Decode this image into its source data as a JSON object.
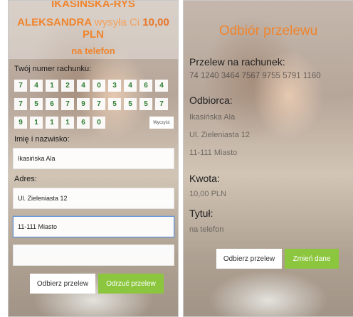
{
  "left": {
    "sender": {
      "name_top": "IKASIŃSKA-RYŚ",
      "name_bottom": "ALEKSANDRA",
      "sends": "wysyła Ci",
      "amount": "10,00",
      "currency": "PLN",
      "title": "na telefon"
    },
    "account_label": "Twój numer rachunku:",
    "digits": [
      [
        "7",
        "4",
        "1",
        "2",
        "4",
        "0",
        "3",
        "4",
        "6",
        "4"
      ],
      [
        "7",
        "5",
        "6",
        "7",
        "9",
        "7",
        "5",
        "5",
        "5",
        "7"
      ],
      [
        "9",
        "1",
        "1",
        "1",
        "6",
        "0"
      ]
    ],
    "clear_label": "Wyczyść",
    "name_label": "Imię i nazwisko:",
    "name_value": "Ikasińska Ala",
    "address_label": "Adres:",
    "address_line1": "Ul. Zieleniasta 12",
    "address_line2": "11-111 Miasto",
    "address_line3": "",
    "accept_label": "Odbierz przelew",
    "reject_label": "Odrzuć przelew"
  },
  "right": {
    "title": "Odbiór przelewu",
    "account_label": "Przelew na rachunek:",
    "account_value": "74 1240 3464 7567 9755 5791 1160",
    "recipient_label": "Odbiorca:",
    "recipient_name": "Ikasińska Ala",
    "recipient_street": "Ul. Zieleniasta 12",
    "recipient_city": "11-111 Miasto",
    "amount_label": "Kwota:",
    "amount_value": "10,00 PLN",
    "title_label": "Tytuł:",
    "title_value": "na telefon",
    "accept_label": "Odbierz przelew",
    "change_label": "Zmień dane"
  },
  "colors": {
    "accent": "#f0842c",
    "digit": "#2e7d32",
    "button_green": "#8cc63f"
  }
}
